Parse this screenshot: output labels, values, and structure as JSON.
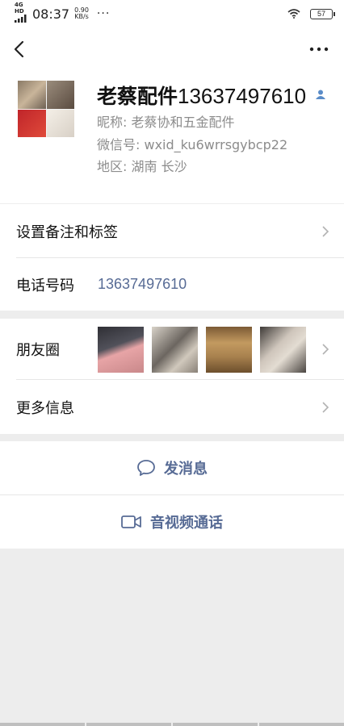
{
  "status_bar": {
    "network": "4G HD",
    "time": "08:37",
    "speed_value": "0.90",
    "speed_unit": "KB/s",
    "more_dots": "···",
    "battery": "57",
    "icons": [
      "signal-icon",
      "wifi-icon",
      "battery-icon"
    ]
  },
  "nav": {
    "back_icon": "chevron-left-icon",
    "more_icon": "more-horizontal-icon"
  },
  "profile": {
    "name": "老蔡配件",
    "name_number": "13637497610",
    "nickname": "昵称:  老蔡协和五金配件",
    "wechat_id": "微信号:  wxid_ku6wrrsgybcp22",
    "region": "地区:  湖南  长沙"
  },
  "rows": {
    "remark_label": "设置备注和标签",
    "phone_label": "电话号码",
    "phone_value": "13637497610",
    "moments_label": "朋友圈",
    "more_info_label": "更多信息"
  },
  "actions": {
    "message_label": "发消息",
    "call_label": "音视频通话"
  },
  "colors": {
    "accent_link": "#576b95",
    "background": "#ededed",
    "person_icon": "#5a8cc8"
  }
}
